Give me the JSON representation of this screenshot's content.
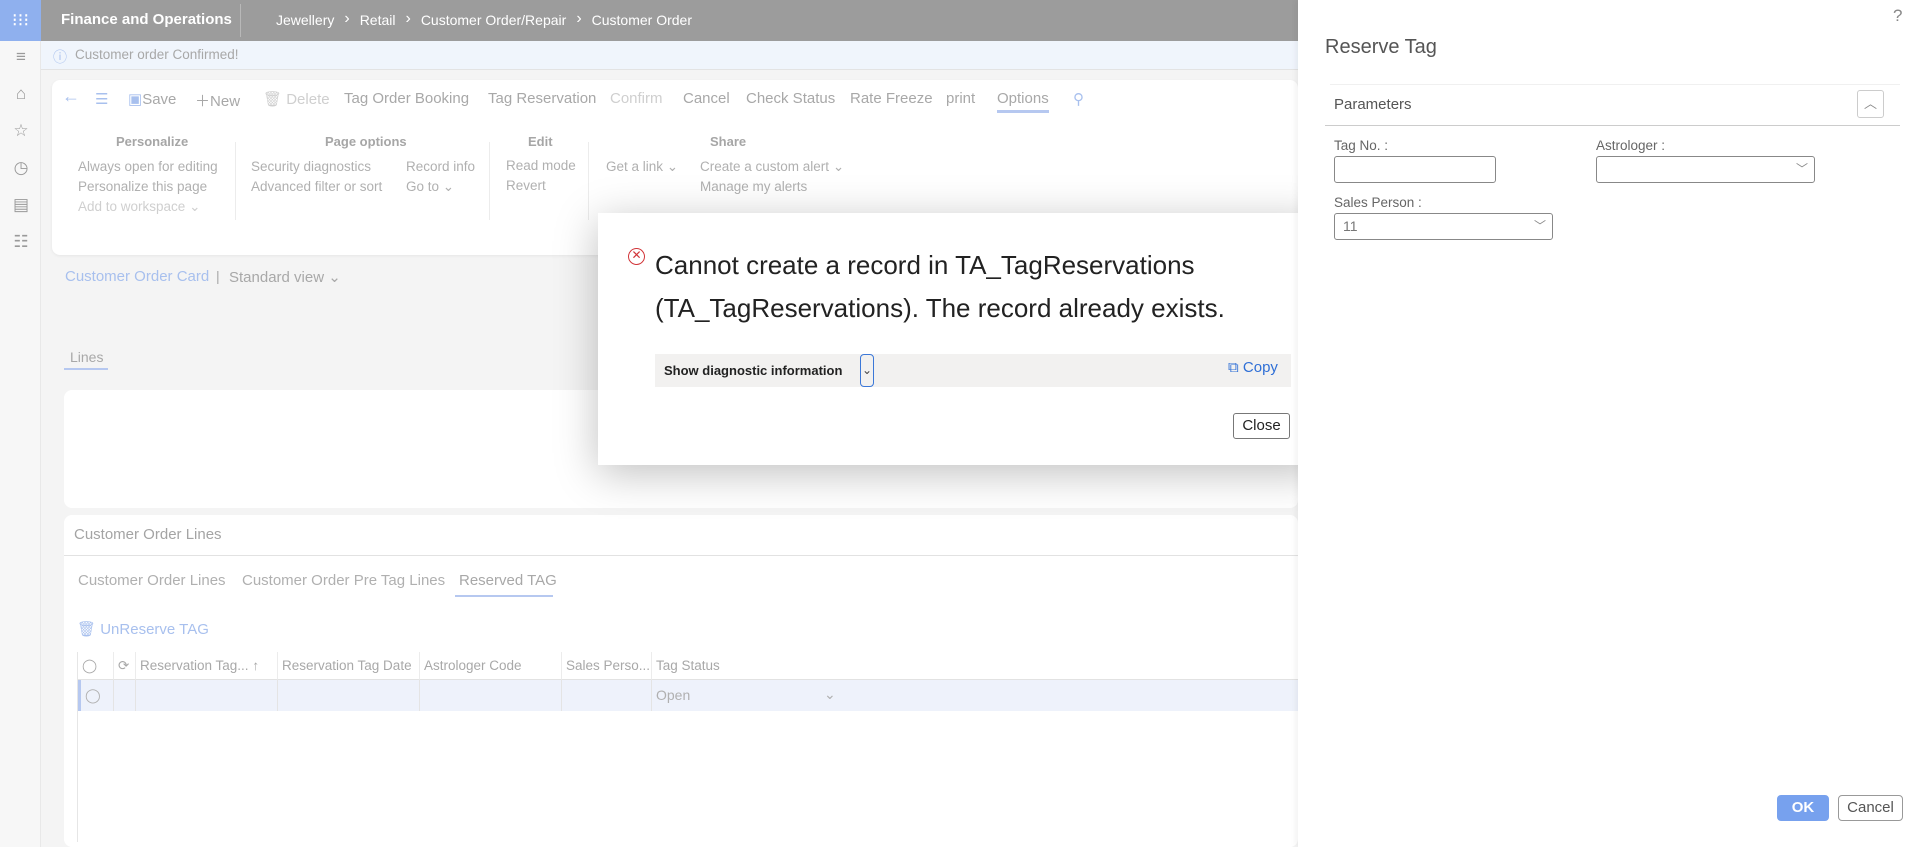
{
  "app": {
    "title": "Finance and Operations",
    "breadcrumb": [
      "Jewellery",
      "Retail",
      "Customer Order/Repair",
      "Customer Order"
    ]
  },
  "info": {
    "message": "Customer order Confirmed!"
  },
  "toolbar": {
    "save": "Save",
    "new": "New",
    "delete": "Delete",
    "tag_order_booking": "Tag Order Booking",
    "tag_reservation": "Tag Reservation",
    "confirm": "Confirm",
    "cancel": "Cancel",
    "check_status": "Check Status",
    "rate_freeze": "Rate Freeze",
    "print": "print",
    "options": "Options"
  },
  "options": {
    "personalize": {
      "header": "Personalize",
      "items": [
        "Always open for editing",
        "Personalize this page",
        "Add to workspace"
      ]
    },
    "page_options": {
      "header": "Page options",
      "items": [
        "Security diagnostics",
        "Advanced filter or sort",
        "Record info",
        "Go to"
      ]
    },
    "edit": {
      "header": "Edit",
      "items": [
        "Read mode",
        "Revert"
      ]
    },
    "share": {
      "header": "Share",
      "items": [
        "Get a link",
        "Create a custom alert",
        "Manage my alerts"
      ]
    }
  },
  "view": {
    "card": "Customer Order Card",
    "separator": "|",
    "standard": "Standard view"
  },
  "lines_tab": "Lines",
  "order_lines": {
    "header": "Customer Order Lines",
    "tabs": [
      "Customer Order Lines",
      "Customer Order Pre Tag Lines",
      "Reserved TAG"
    ],
    "unreserve": "UnReserve TAG",
    "columns": [
      "Reservation Tag...",
      "Reservation Tag Date",
      "Astrologer Code",
      "Sales Perso...",
      "Tag Status"
    ],
    "rows": [
      {
        "tag_status": "Open"
      }
    ]
  },
  "dialog": {
    "message": "Cannot create a record in TA_TagReservations (TA_TagReservations). The record already exists.",
    "diagnostic": "Show diagnostic information",
    "copy": "Copy",
    "close": "Close"
  },
  "panel": {
    "help": "?",
    "title": "Reserve Tag",
    "section": "Parameters",
    "tag_no_label": "Tag No. :",
    "tag_no_value": "",
    "astrologer_label": "Astrologer :",
    "astrologer_value": "",
    "sales_person_label": "Sales Person :",
    "sales_person_value": "11",
    "ok": "OK",
    "cancel": "Cancel"
  }
}
